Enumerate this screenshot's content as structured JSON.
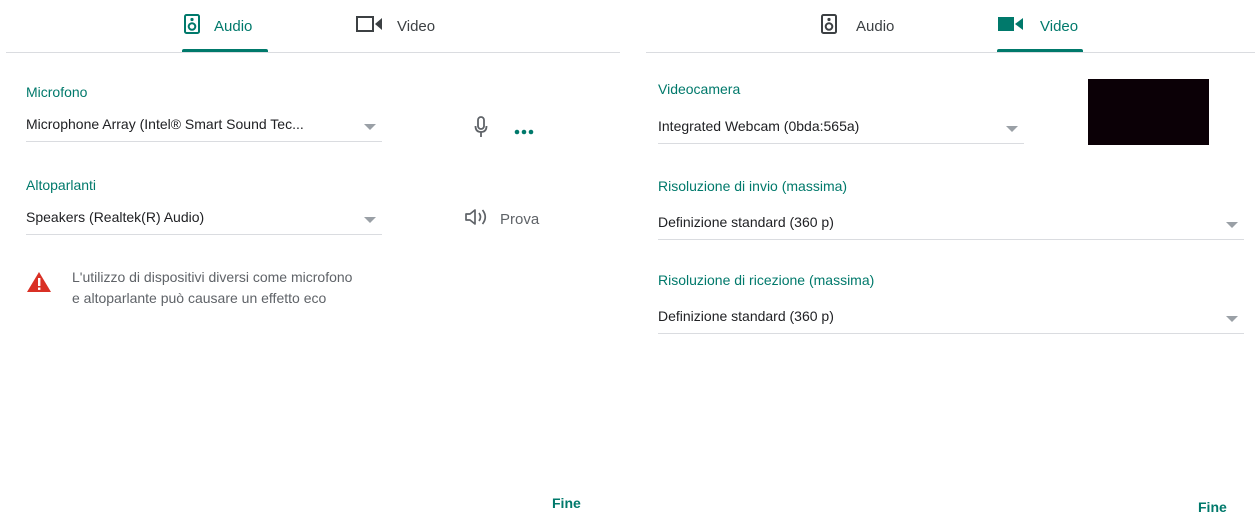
{
  "colors": {
    "accent": "#00796b",
    "warning": "#d93025",
    "preview": "#0b0006"
  },
  "left": {
    "tabs": [
      {
        "label": "Audio",
        "icon": "speaker-icon",
        "active": true
      },
      {
        "label": "Video",
        "icon": "videocam-outline-icon",
        "active": false
      }
    ],
    "microphone": {
      "label": "Microfono",
      "value": "Microphone Array (Intel® Smart Sound Tec...",
      "icons": [
        "mic-icon",
        "more-options-icon"
      ]
    },
    "speakers": {
      "label": "Altoparlanti",
      "value": "Speakers (Realtek(R) Audio)",
      "test_label": "Prova"
    },
    "warning": {
      "line1": "L'utilizzo di dispositivi diversi come microfono",
      "line2": "e altoparlante può causare un effetto eco"
    },
    "done_label": "Fine"
  },
  "right": {
    "tabs": [
      {
        "label": "Audio",
        "icon": "speaker-icon",
        "active": false
      },
      {
        "label": "Video",
        "icon": "videocam-icon",
        "active": true
      }
    ],
    "camera": {
      "label": "Videocamera",
      "value": "Integrated Webcam (0bda:565a)"
    },
    "send_resolution": {
      "label": "Risoluzione di invio (massima)",
      "value": "Definizione standard (360 p)"
    },
    "receive_resolution": {
      "label": "Risoluzione di ricezione (massima)",
      "value": "Definizione standard (360 p)"
    },
    "done_label": "Fine"
  }
}
